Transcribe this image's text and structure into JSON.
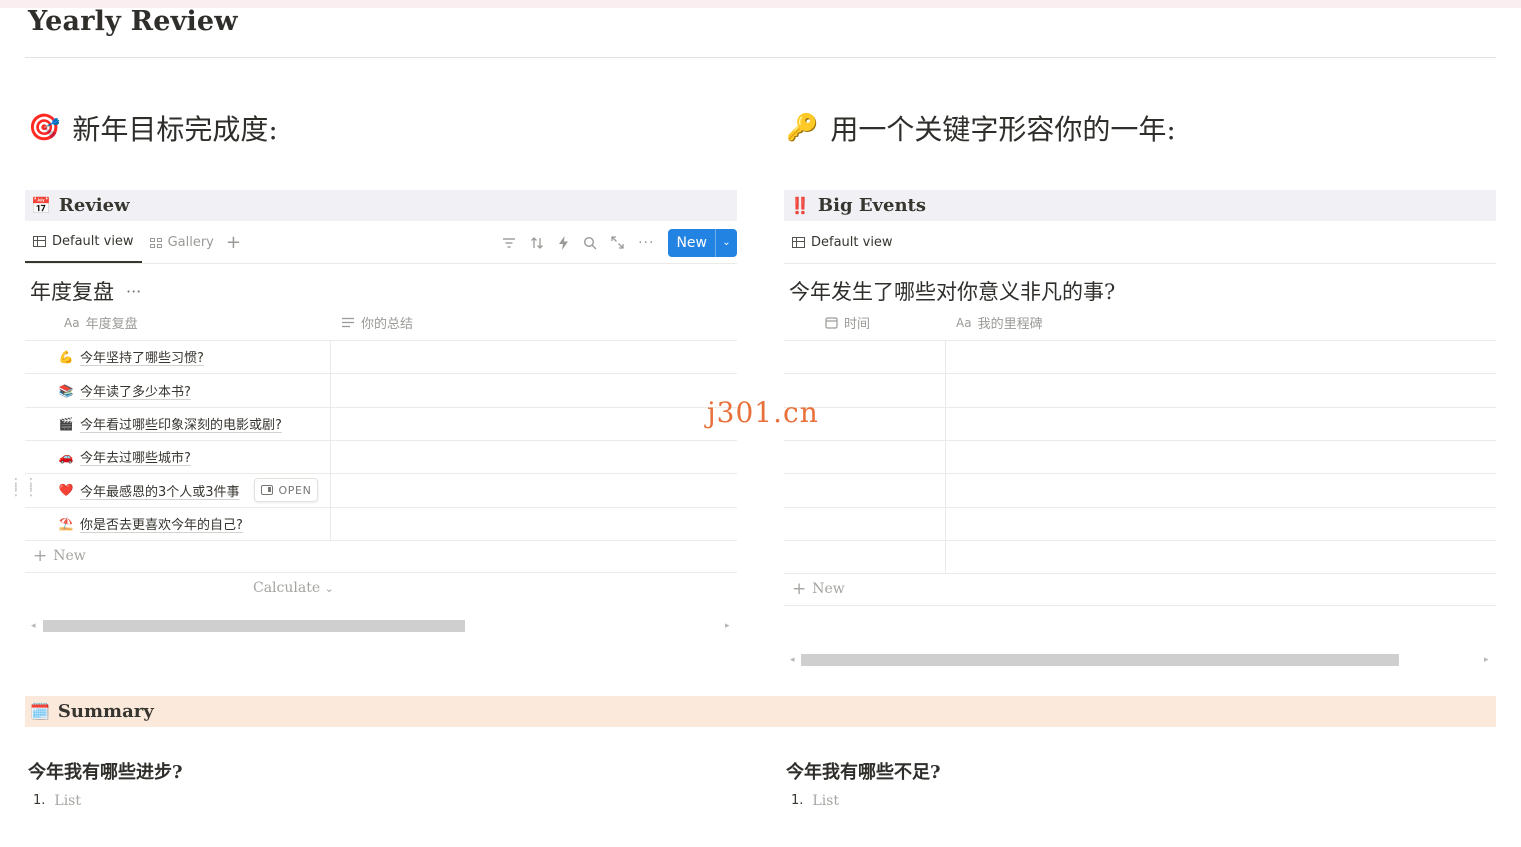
{
  "page": {
    "title": "Yearly Review"
  },
  "left_heading": {
    "emoji": "🎯",
    "text": "新年目标完成度:"
  },
  "right_heading": {
    "emoji": "🔑",
    "text": "用一个关键字形容你的一年:"
  },
  "review_db": {
    "emoji": "📅",
    "name": "Review",
    "views": [
      "Default view",
      "Gallery"
    ],
    "new_label": "New",
    "table_title": "年度复盘",
    "more": "···",
    "columns": [
      {
        "icon": "Aa",
        "label": "年度复盘"
      },
      {
        "icon": "lines-icon",
        "label": "你的总结"
      }
    ],
    "rows": [
      {
        "emoji": "💪",
        "title": "今年坚持了哪些习惯?"
      },
      {
        "emoji": "📚",
        "title": "今年读了多少本书?"
      },
      {
        "emoji": "🎬",
        "title": "今年看过哪些印象深刻的电影或剧?"
      },
      {
        "emoji": "🚗",
        "title": "今年去过哪些城市?"
      },
      {
        "emoji": "❤️",
        "title": "今年最感恩的3个人或3件事",
        "open_label": "OPEN"
      },
      {
        "emoji": "⛱️",
        "title": "你是否去更喜欢今年的自己?"
      }
    ],
    "add_row_label": "New",
    "calculate_label": "Calculate",
    "scroll_fraction": 0.62
  },
  "events_db": {
    "emoji": "‼️",
    "name": "Big Events",
    "views": [
      "Default view"
    ],
    "table_title": "今年发生了哪些对你意义非凡的事?",
    "columns": [
      {
        "icon": "calendar-icon",
        "label": "时间"
      },
      {
        "icon": "Aa",
        "label": "我的里程碑"
      }
    ],
    "empty_rows": 6,
    "add_row_label": "New",
    "scroll_fraction": 0.88
  },
  "summary": {
    "emoji": "🗓️",
    "name": "Summary",
    "left": {
      "question": "今年我有哪些进步?",
      "num": "1.",
      "placeholder": "List"
    },
    "right": {
      "question": "今年我有哪些不足?",
      "num": "1.",
      "placeholder": "List"
    }
  },
  "watermark": "j301.cn",
  "colors": {
    "accent": "#2383e2",
    "db_header": "#f1f1f5",
    "summary_header": "#fbe9dc",
    "watermark": "#e8703a"
  }
}
